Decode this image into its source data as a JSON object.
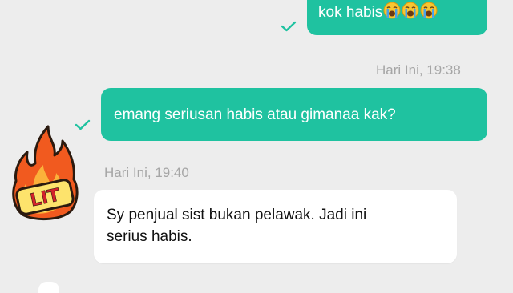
{
  "colors": {
    "background": "#ededed",
    "outgoing_bubble": "#1fc2a0",
    "incoming_bubble": "#ffffff",
    "check": "#1fc2a0",
    "timestamp": "#a6a6a6"
  },
  "messages": [
    {
      "direction": "outgoing",
      "text": "kok habis",
      "emoji": [
        "loudly-crying-face",
        "loudly-crying-face",
        "loudly-crying-face"
      ],
      "status_icon": "check-icon"
    },
    {
      "direction": "outgoing",
      "timestamp": "Hari Ini, 19:38",
      "text": "emang seriusan habis atau gimanaa kak?",
      "status_icon": "check-icon"
    },
    {
      "direction": "incoming",
      "timestamp": "Hari Ini, 19:40",
      "text_line1": "Sy penjual sist bukan pelawak. Jadi ini",
      "text_line2": "serius habis.",
      "avatar_sticker": "lit-fire-sticker",
      "sticker_text": "LIT"
    }
  ]
}
